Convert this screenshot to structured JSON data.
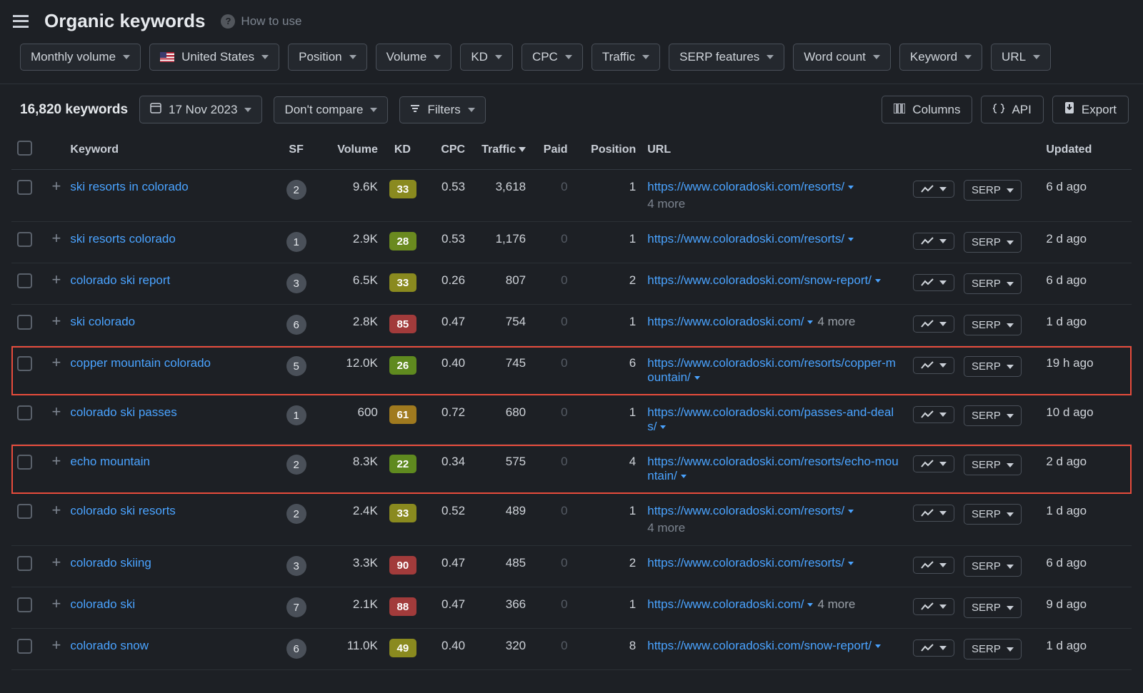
{
  "header": {
    "title": "Organic keywords",
    "howToUse": "How to use"
  },
  "filters": {
    "monthlyVolume": "Monthly volume",
    "country": "United States",
    "position": "Position",
    "volume": "Volume",
    "kd": "KD",
    "cpc": "CPC",
    "traffic": "Traffic",
    "serpFeatures": "SERP features",
    "wordCount": "Word count",
    "keyword": "Keyword",
    "url": "URL"
  },
  "toolbar": {
    "count": "16,820 keywords",
    "date": "17 Nov 2023",
    "compare": "Don't compare",
    "filters": "Filters",
    "columns": "Columns",
    "api": "API",
    "export": "Export"
  },
  "columns": {
    "keyword": "Keyword",
    "sf": "SF",
    "volume": "Volume",
    "kd": "KD",
    "cpc": "CPC",
    "traffic": "Traffic",
    "paid": "Paid",
    "position": "Position",
    "url": "URL",
    "updated": "Updated"
  },
  "serpLabel": "SERP",
  "rows": [
    {
      "keyword": "ski resorts in colorado",
      "sf": "2",
      "volume": "9.6K",
      "kd": "33",
      "kdColor": "#8a8a1f",
      "cpc": "0.53",
      "traffic": "3,618",
      "paid": "0",
      "position": "1",
      "url": "https://www.coloradoski.com/resorts/",
      "more": "4 more",
      "moreInline": false,
      "updated": "6 d ago",
      "highlight": false
    },
    {
      "keyword": "ski resorts colorado",
      "sf": "1",
      "volume": "2.9K",
      "kd": "28",
      "kdColor": "#6a8a1f",
      "cpc": "0.53",
      "traffic": "1,176",
      "paid": "0",
      "position": "1",
      "url": "https://www.coloradoski.com/resorts/",
      "more": "",
      "moreInline": false,
      "updated": "2 d ago",
      "highlight": false
    },
    {
      "keyword": "colorado ski report",
      "sf": "3",
      "volume": "6.5K",
      "kd": "33",
      "kdColor": "#8a8a1f",
      "cpc": "0.26",
      "traffic": "807",
      "paid": "0",
      "position": "2",
      "url": "https://www.coloradoski.com/snow-report/",
      "more": "",
      "moreInline": false,
      "updated": "6 d ago",
      "highlight": false
    },
    {
      "keyword": "ski colorado",
      "sf": "6",
      "volume": "2.8K",
      "kd": "85",
      "kdColor": "#a23b3b",
      "cpc": "0.47",
      "traffic": "754",
      "paid": "0",
      "position": "1",
      "url": "https://www.coloradoski.com/",
      "more": "4 more",
      "moreInline": true,
      "updated": "1 d ago",
      "highlight": false
    },
    {
      "keyword": "copper mountain colorado",
      "sf": "5",
      "volume": "12.0K",
      "kd": "26",
      "kdColor": "#5f8a1f",
      "cpc": "0.40",
      "traffic": "745",
      "paid": "0",
      "position": "6",
      "url": "https://www.coloradoski.com/resorts/copper-mountain/",
      "more": "",
      "moreInline": false,
      "updated": "19 h ago",
      "highlight": true
    },
    {
      "keyword": "colorado ski passes",
      "sf": "1",
      "volume": "600",
      "kd": "61",
      "kdColor": "#a07a1f",
      "cpc": "0.72",
      "traffic": "680",
      "paid": "0",
      "position": "1",
      "url": "https://www.coloradoski.com/passes-and-deals/",
      "more": "",
      "moreInline": false,
      "updated": "10 d ago",
      "highlight": false
    },
    {
      "keyword": "echo mountain",
      "sf": "2",
      "volume": "8.3K",
      "kd": "22",
      "kdColor": "#5f8a1f",
      "cpc": "0.34",
      "traffic": "575",
      "paid": "0",
      "position": "4",
      "url": "https://www.coloradoski.com/resorts/echo-mountain/",
      "more": "",
      "moreInline": false,
      "updated": "2 d ago",
      "highlight": true
    },
    {
      "keyword": "colorado ski resorts",
      "sf": "2",
      "volume": "2.4K",
      "kd": "33",
      "kdColor": "#8a8a1f",
      "cpc": "0.52",
      "traffic": "489",
      "paid": "0",
      "position": "1",
      "url": "https://www.coloradoski.com/resorts/",
      "more": "4 more",
      "moreInline": false,
      "updated": "1 d ago",
      "highlight": false
    },
    {
      "keyword": "colorado skiing",
      "sf": "3",
      "volume": "3.3K",
      "kd": "90",
      "kdColor": "#a23b3b",
      "cpc": "0.47",
      "traffic": "485",
      "paid": "0",
      "position": "2",
      "url": "https://www.coloradoski.com/resorts/",
      "more": "",
      "moreInline": false,
      "updated": "6 d ago",
      "highlight": false
    },
    {
      "keyword": "colorado ski",
      "sf": "7",
      "volume": "2.1K",
      "kd": "88",
      "kdColor": "#a23b3b",
      "cpc": "0.47",
      "traffic": "366",
      "paid": "0",
      "position": "1",
      "url": "https://www.coloradoski.com/",
      "more": "4 more",
      "moreInline": true,
      "updated": "9 d ago",
      "highlight": false
    },
    {
      "keyword": "colorado snow",
      "sf": "6",
      "volume": "11.0K",
      "kd": "49",
      "kdColor": "#8a8a1f",
      "cpc": "0.40",
      "traffic": "320",
      "paid": "0",
      "position": "8",
      "url": "https://www.coloradoski.com/snow-report/",
      "more": "",
      "moreInline": false,
      "updated": "1 d ago",
      "highlight": false
    }
  ]
}
